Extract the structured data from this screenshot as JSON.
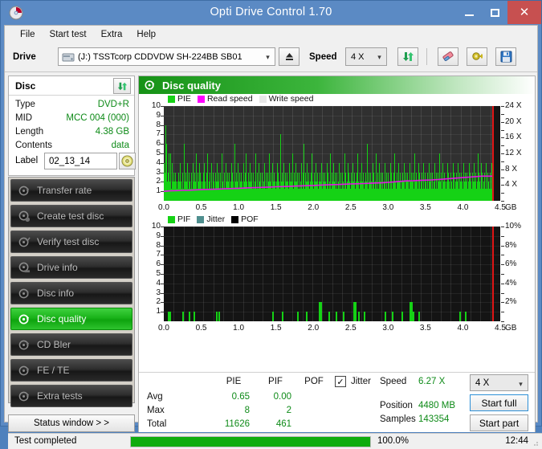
{
  "window": {
    "title": "Opti Drive Control 1.70",
    "icon": "disc-icon",
    "minimize_label": "–",
    "maximize_label": "□",
    "close_label": "✕"
  },
  "menu": {
    "items": [
      {
        "label": "File"
      },
      {
        "label": "Start test"
      },
      {
        "label": "Extra"
      },
      {
        "label": "Help"
      }
    ]
  },
  "toolbar": {
    "drive_label": "Drive",
    "drive_value": "(J:)  TSSTcorp CDDVDW SH-224BB SB01",
    "eject_icon": "eject-icon",
    "speed_label": "Speed",
    "speed_value": "4 X",
    "refresh_icon": "refresh-icon",
    "erase_icon": "eraser-icon",
    "settings_icon": "gear-icon",
    "save_icon": "save-icon",
    "dropdown_icon": "chevron-down-icon"
  },
  "disc_panel": {
    "title": "Disc",
    "refresh_icon": "refresh-icon",
    "rows": [
      {
        "key": "Type",
        "value": "DVD+R"
      },
      {
        "key": "MID",
        "value": "MCC 004 (000)"
      },
      {
        "key": "Length",
        "value": "4.38 GB"
      },
      {
        "key": "Contents",
        "value": "data"
      }
    ],
    "label_key": "Label",
    "label_value": "02_13_14",
    "label_placeholder": "",
    "cd_icon": "cd-icon"
  },
  "sidebar": {
    "items": [
      {
        "label": "Transfer rate",
        "icon": "disc-test-icon",
        "active": false
      },
      {
        "label": "Create test disc",
        "icon": "disc-create-icon",
        "active": false
      },
      {
        "label": "Verify test disc",
        "icon": "disc-verify-icon",
        "active": false
      },
      {
        "label": "Drive info",
        "icon": "drive-info-icon",
        "active": false
      },
      {
        "label": "Disc info",
        "icon": "disc-info-icon",
        "active": false
      },
      {
        "label": "Disc quality",
        "icon": "disc-quality-icon",
        "active": true
      },
      {
        "label": "CD Bler",
        "icon": "disc-bler-icon",
        "active": false
      },
      {
        "label": "FE / TE",
        "icon": "disc-fete-icon",
        "active": false
      },
      {
        "label": "Extra tests",
        "icon": "disc-extra-icon",
        "active": false
      }
    ],
    "status_window_label": "Status window > >"
  },
  "main": {
    "header_title": "Disc quality",
    "header_icon": "disc-quality-icon"
  },
  "stats": {
    "col_headers": [
      "PIE",
      "PIF",
      "POF"
    ],
    "jitter_label": "Jitter",
    "jitter_checked": true,
    "rows": [
      {
        "name": "Avg",
        "pie": "0.65",
        "pif": "0.00",
        "pof": ""
      },
      {
        "name": "Max",
        "pie": "8",
        "pif": "2",
        "pof": ""
      },
      {
        "name": "Total",
        "pie": "11626",
        "pif": "461",
        "pof": ""
      }
    ],
    "speed_label": "Speed",
    "speed_value": "6.27 X",
    "position_label": "Position",
    "position_value": "4480 MB",
    "samples_label": "Samples",
    "samples_value": "143354",
    "speed_select": "4 X",
    "start_full_label": "Start full",
    "start_part_label": "Start part"
  },
  "statusbar": {
    "text": "Test completed",
    "percent_label": "100.0%",
    "percent_value": 100,
    "time": "12:44"
  },
  "colors": {
    "titlebar": "#5b8ac4",
    "close": "#c75050",
    "accent_green": "#0d8a17",
    "bar_green": "#15d215",
    "read_speed": "#e316e3",
    "marker_red": "#e01616",
    "plot_bg": "#303030",
    "plot_bg_dark": "#101010"
  },
  "chart_data": [
    {
      "type": "bar",
      "title": "Disc quality - PIE",
      "xlabel": "GB",
      "ylabel": "PIE",
      "y2label": "Read speed (X)",
      "legend": [
        {
          "name": "PIE",
          "color": "#15d215"
        },
        {
          "name": "Read speed",
          "color": "#ff00ff"
        },
        {
          "name": "Write speed",
          "color": "#e8e8e8"
        }
      ],
      "legend_position": "top-left",
      "grid": true,
      "xlim": [
        0.0,
        4.5
      ],
      "xticks": [
        "0.0",
        "0.5",
        "1.0",
        "1.5",
        "2.0",
        "2.5",
        "3.0",
        "3.5",
        "4.0",
        "4.5"
      ],
      "xtick_suffix": "GB",
      "ylim": [
        0,
        10
      ],
      "yticks": [
        1,
        2,
        3,
        4,
        5,
        6,
        7,
        8,
        9,
        10
      ],
      "y2lim": [
        0,
        24
      ],
      "y2ticks": [
        "4 X",
        "8 X",
        "12 X",
        "16 X",
        "20 X",
        "24 X"
      ],
      "marker_x": 4.39,
      "series": [
        {
          "name": "PIE",
          "note": "per-sample PIE counts along the disc radius (0..4.5 GB)",
          "values": [
            4,
            3,
            8,
            3,
            6,
            2,
            3,
            5,
            2,
            3,
            5,
            1,
            4,
            2,
            3,
            2,
            1,
            3,
            2,
            1,
            2,
            3,
            1,
            2,
            4,
            2,
            1,
            3,
            2,
            1,
            6,
            2,
            3,
            1,
            2,
            4,
            1,
            3,
            2,
            1,
            3,
            2,
            1,
            4,
            2,
            3,
            1,
            2,
            5,
            1,
            3,
            2,
            4,
            1,
            3,
            2,
            1,
            2,
            3,
            1,
            4,
            2,
            1,
            3,
            2,
            5,
            1,
            2,
            3,
            1,
            2,
            4,
            1,
            3,
            2,
            1,
            3,
            2,
            1,
            4,
            2,
            3,
            1,
            2,
            3,
            1,
            5,
            2,
            1,
            3,
            2,
            1,
            4,
            2,
            3,
            1,
            2,
            3,
            1,
            2,
            4,
            1,
            3,
            2,
            1,
            6,
            2,
            3,
            1,
            2,
            4,
            1,
            3,
            2,
            1,
            3,
            2,
            1,
            4,
            2,
            3,
            1,
            5,
            2,
            1,
            3,
            2,
            1,
            4,
            2,
            3,
            1,
            2,
            3,
            1,
            2,
            5,
            1,
            3,
            2,
            1,
            4,
            2,
            3,
            1,
            2,
            3,
            1,
            2,
            4,
            1,
            3,
            2,
            1,
            3,
            2,
            5,
            1,
            2,
            3,
            1,
            4,
            2,
            1,
            3,
            2,
            1,
            2,
            4,
            1,
            3,
            2,
            1,
            7,
            2,
            3,
            1,
            2,
            4,
            1,
            3,
            2,
            1,
            3,
            2,
            1,
            4,
            2,
            3,
            1,
            2,
            5,
            1,
            3,
            2,
            1,
            4,
            2,
            3,
            1,
            2,
            3,
            1,
            2,
            4,
            1,
            3,
            2,
            6,
            1,
            3,
            2,
            1,
            4,
            2,
            3,
            1,
            2,
            3,
            1,
            5,
            2,
            1,
            3,
            2,
            1,
            4,
            2,
            3,
            1,
            2,
            3,
            1,
            2,
            4,
            1,
            3,
            2,
            1,
            3,
            2,
            1,
            4,
            2,
            3,
            1,
            2,
            5,
            1,
            3,
            2,
            1,
            4,
            2,
            3,
            1,
            2,
            3,
            1,
            2,
            4,
            1,
            3,
            2,
            1,
            3,
            2,
            1,
            5,
            2,
            3,
            1,
            2,
            4,
            1,
            3,
            2,
            1,
            3,
            2,
            1,
            4,
            2,
            3,
            1,
            2,
            3,
            1,
            5,
            2,
            1,
            3,
            2,
            1,
            4,
            2,
            3,
            1,
            2,
            3,
            1,
            2,
            6,
            1,
            3,
            2,
            1,
            3,
            2,
            1,
            4,
            2,
            3,
            1,
            2,
            5,
            1,
            3,
            2,
            1,
            4,
            2,
            3,
            1,
            2,
            3,
            1,
            2,
            4,
            1,
            3,
            2,
            1,
            3,
            2,
            1,
            4,
            2,
            3,
            1,
            2,
            3,
            1,
            5,
            2,
            1,
            3,
            2,
            1,
            4,
            2,
            3,
            1,
            2,
            3,
            1,
            2,
            4,
            1,
            3,
            2,
            1,
            3,
            2,
            1,
            4,
            2,
            3,
            1,
            2,
            3,
            1,
            5,
            2,
            1,
            3,
            2,
            1,
            4,
            2,
            3,
            1,
            2,
            3,
            1,
            2,
            4,
            1,
            3,
            2,
            1,
            3,
            2,
            1,
            4,
            2,
            3,
            1,
            2,
            3,
            1,
            2,
            4,
            1,
            3,
            2,
            1,
            3,
            2,
            5,
            1,
            2,
            3,
            1,
            4,
            2,
            1,
            3,
            2,
            1,
            2,
            4,
            1,
            3,
            2,
            1,
            3,
            2,
            1,
            4,
            2,
            3,
            1,
            2,
            3,
            1,
            2,
            4,
            1,
            3,
            2,
            1,
            3,
            2,
            1,
            4,
            2,
            3,
            1,
            2,
            3,
            1,
            2,
            4,
            1,
            3,
            2,
            1,
            3,
            2,
            1,
            4,
            2,
            3,
            1,
            2,
            5,
            1,
            3,
            2,
            1,
            4,
            2,
            3,
            1,
            2,
            3,
            1,
            2,
            4,
            1,
            3,
            2,
            1,
            3,
            2,
            1,
            4,
            2,
            3,
            1,
            2,
            3,
            1,
            2,
            4,
            1,
            3,
            2,
            1
          ]
        },
        {
          "name": "Read speed",
          "note": "magenta line, left-scaled; rises from ~1 to ~2.6 of the 0-10 axis",
          "values": [
            1.0,
            1.05,
            1.08,
            1.1,
            1.12,
            1.15,
            1.18,
            1.2,
            1.22,
            1.25,
            1.28,
            1.3,
            1.32,
            1.35,
            1.38,
            1.4,
            1.42,
            1.45,
            1.48,
            1.5,
            1.52,
            1.55,
            1.58,
            1.6,
            1.62,
            1.65,
            1.68,
            1.7,
            1.72,
            1.75,
            1.78,
            1.8,
            1.82,
            1.85,
            1.88,
            1.9,
            1.95,
            2.0,
            2.05,
            2.1,
            2.12,
            2.15,
            2.18,
            2.2,
            2.25,
            2.3,
            2.35,
            2.4,
            2.45,
            2.5,
            2.55,
            2.6,
            2.6,
            2.6,
            2.6
          ]
        }
      ]
    },
    {
      "type": "bar",
      "title": "Disc quality - PIF",
      "xlabel": "GB",
      "ylabel": "PIF",
      "y2label": "Jitter (%)",
      "legend": [
        {
          "name": "PIF",
          "color": "#15d215"
        },
        {
          "name": "Jitter",
          "color": "#4f8f8f"
        },
        {
          "name": "POF",
          "color": "#000000"
        }
      ],
      "legend_position": "top-left",
      "grid": true,
      "xlim": [
        0.0,
        4.5
      ],
      "xticks": [
        "0.0",
        "0.5",
        "1.0",
        "1.5",
        "2.0",
        "2.5",
        "3.0",
        "3.5",
        "4.0",
        "4.5"
      ],
      "xtick_suffix": "GB",
      "ylim": [
        0,
        10
      ],
      "yticks": [
        1,
        2,
        3,
        4,
        5,
        6,
        7,
        8,
        9,
        10
      ],
      "y2lim": [
        0,
        10
      ],
      "y2ticks": [
        "2%",
        "4%",
        "6%",
        "8%",
        "10%"
      ],
      "marker_x": 4.39,
      "series": [
        {
          "name": "PIF",
          "note": "sparse spikes; x positions in GB with heights in PIF counts",
          "points": [
            {
              "x": 0.05,
              "y": 1
            },
            {
              "x": 0.08,
              "y": 1
            },
            {
              "x": 0.25,
              "y": 1
            },
            {
              "x": 0.33,
              "y": 1
            },
            {
              "x": 0.4,
              "y": 1
            },
            {
              "x": 0.7,
              "y": 1
            },
            {
              "x": 0.73,
              "y": 1
            },
            {
              "x": 1.45,
              "y": 1
            },
            {
              "x": 1.58,
              "y": 1
            },
            {
              "x": 1.78,
              "y": 1
            },
            {
              "x": 1.9,
              "y": 1
            },
            {
              "x": 2.07,
              "y": 2
            },
            {
              "x": 2.2,
              "y": 1
            },
            {
              "x": 2.3,
              "y": 1
            },
            {
              "x": 2.4,
              "y": 1
            },
            {
              "x": 2.53,
              "y": 2
            },
            {
              "x": 2.6,
              "y": 1
            },
            {
              "x": 2.67,
              "y": 1
            },
            {
              "x": 2.95,
              "y": 1
            },
            {
              "x": 3.05,
              "y": 1
            },
            {
              "x": 3.18,
              "y": 1
            },
            {
              "x": 3.29,
              "y": 2
            },
            {
              "x": 3.33,
              "y": 1
            },
            {
              "x": 3.4,
              "y": 1
            },
            {
              "x": 3.95,
              "y": 1
            },
            {
              "x": 4.03,
              "y": 1
            }
          ]
        }
      ]
    }
  ]
}
